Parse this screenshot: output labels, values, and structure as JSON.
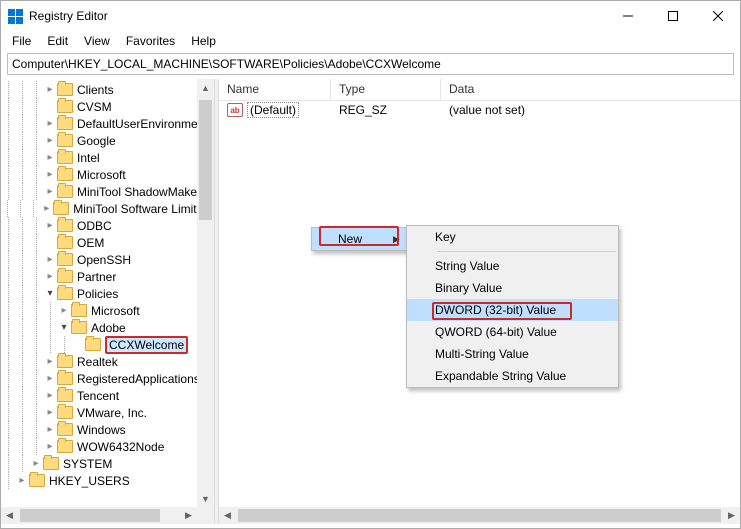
{
  "window": {
    "title": "Registry Editor"
  },
  "menubar": [
    "File",
    "Edit",
    "View",
    "Favorites",
    "Help"
  ],
  "address": "Computer\\HKEY_LOCAL_MACHINE\\SOFTWARE\\Policies\\Adobe\\CCXWelcome",
  "tree": {
    "rows": [
      {
        "indent": 3,
        "chev": "closed",
        "label": "Clients"
      },
      {
        "indent": 3,
        "chev": "none",
        "label": "CVSM"
      },
      {
        "indent": 3,
        "chev": "closed",
        "label": "DefaultUserEnvironment"
      },
      {
        "indent": 3,
        "chev": "closed",
        "label": "Google"
      },
      {
        "indent": 3,
        "chev": "closed",
        "label": "Intel"
      },
      {
        "indent": 3,
        "chev": "closed",
        "label": "Microsoft"
      },
      {
        "indent": 3,
        "chev": "closed",
        "label": "MiniTool ShadowMaker"
      },
      {
        "indent": 3,
        "chev": "closed",
        "label": "MiniTool Software Limited"
      },
      {
        "indent": 3,
        "chev": "closed",
        "label": "ODBC"
      },
      {
        "indent": 3,
        "chev": "none",
        "label": "OEM"
      },
      {
        "indent": 3,
        "chev": "closed",
        "label": "OpenSSH"
      },
      {
        "indent": 3,
        "chev": "closed",
        "label": "Partner"
      },
      {
        "indent": 3,
        "chev": "open",
        "label": "Policies"
      },
      {
        "indent": 4,
        "chev": "closed",
        "label": "Microsoft"
      },
      {
        "indent": 4,
        "chev": "open",
        "label": "Adobe"
      },
      {
        "indent": 5,
        "chev": "none",
        "label": "CCXWelcome",
        "selected": true,
        "highlight": true
      },
      {
        "indent": 3,
        "chev": "closed",
        "label": "Realtek"
      },
      {
        "indent": 3,
        "chev": "closed",
        "label": "RegisteredApplications"
      },
      {
        "indent": 3,
        "chev": "closed",
        "label": "Tencent"
      },
      {
        "indent": 3,
        "chev": "closed",
        "label": "VMware, Inc."
      },
      {
        "indent": 3,
        "chev": "closed",
        "label": "Windows"
      },
      {
        "indent": 3,
        "chev": "closed",
        "label": "WOW6432Node"
      },
      {
        "indent": 2,
        "chev": "closed",
        "label": "SYSTEM"
      },
      {
        "indent": 1,
        "chev": "closed",
        "label": "HKEY_USERS"
      }
    ]
  },
  "list": {
    "columns": [
      "Name",
      "Type",
      "Data"
    ],
    "rows": [
      {
        "icon": "ab",
        "name": "(Default)",
        "type": "REG_SZ",
        "data": "(value not set)"
      }
    ]
  },
  "context": {
    "parent": {
      "label": "New"
    },
    "sub": [
      {
        "label": "Key"
      },
      {
        "sep": true
      },
      {
        "label": "String Value"
      },
      {
        "label": "Binary Value"
      },
      {
        "label": "DWORD (32-bit) Value",
        "hi": true,
        "highlight": true
      },
      {
        "label": "QWORD (64-bit) Value"
      },
      {
        "label": "Multi-String Value"
      },
      {
        "label": "Expandable String Value"
      }
    ]
  }
}
